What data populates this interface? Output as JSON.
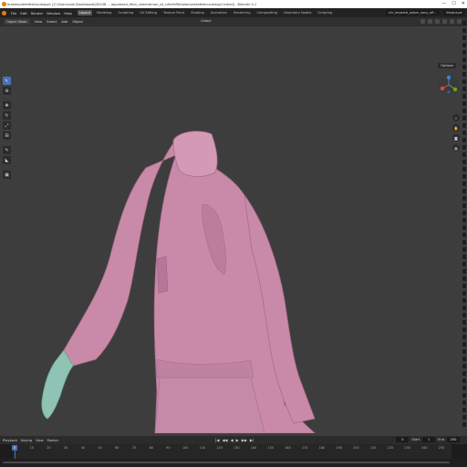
{
  "window": {
    "title": "brokenpraketttercouhapp1 [C:\\Users\\user\\Downloads\\30248 ... appraised_ftfan_cameraman_v4_nfhcfeff\\brokenpraketttercouhapp1.blend] - Blender 4.1",
    "controls": [
      "—",
      "☐",
      "✕"
    ]
  },
  "menu": {
    "items": [
      "File",
      "Edit",
      "Render",
      "Window",
      "Help"
    ]
  },
  "workspaces": {
    "tabs": [
      "Layout",
      "Modeling",
      "Sculpting",
      "UV Editing",
      "Texture Paint",
      "Shading",
      "Animation",
      "Rendering",
      "Compositing",
      "Geometry Nodes",
      "Scripting"
    ],
    "active": "Layout"
  },
  "topbar_right": {
    "scene": "chr_imperial_adam_navy_off...",
    "view_layer": "ViewLayer"
  },
  "header": {
    "mode": "Object Mode",
    "items": [
      "View",
      "Select",
      "Add",
      "Object"
    ],
    "transform": "Global"
  },
  "viewport": {
    "options_label": "Options"
  },
  "tools": [
    "cursor",
    "select",
    "move",
    "rotate",
    "scale",
    "transform",
    "annotate",
    "measure",
    "add-cube"
  ],
  "gizmo": {
    "axes": [
      "Z",
      "X",
      "Y"
    ],
    "colors": {
      "x": "#e0444e",
      "y": "#6ea324",
      "z": "#3b82d6"
    }
  },
  "timeline": {
    "header_items": [
      "Playback",
      "Keying",
      "View",
      "Marker"
    ],
    "transport": [
      "|◀",
      "◀◀",
      "◀",
      "▶",
      "▶▶",
      "▶|"
    ],
    "current_frame": "0",
    "start_label": "Start",
    "start": "1",
    "end_label": "End",
    "end": "250",
    "ruler": [
      "0",
      "10",
      "20",
      "30",
      "40",
      "50",
      "60",
      "70",
      "80",
      "90",
      "100",
      "110",
      "120",
      "130",
      "140",
      "150",
      "160",
      "170",
      "180",
      "190",
      "200",
      "210",
      "220",
      "230",
      "240",
      "250"
    ]
  },
  "colors": {
    "accent": "#4772b3",
    "viewport_bg": "#3d3d3d",
    "cloth": "#c98aa9",
    "hand": "#8fc3b4"
  }
}
